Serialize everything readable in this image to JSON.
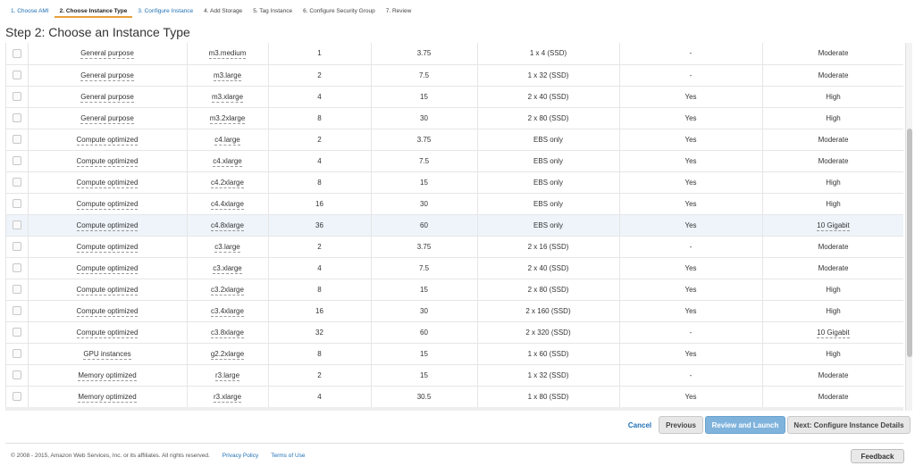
{
  "wizard": {
    "steps": [
      {
        "label": "1. Choose AMI"
      },
      {
        "label": "2. Choose Instance Type"
      },
      {
        "label": "3. Configure Instance"
      },
      {
        "label": "4. Add Storage"
      },
      {
        "label": "5. Tag Instance"
      },
      {
        "label": "6. Configure Security Group"
      },
      {
        "label": "7. Review"
      }
    ]
  },
  "page": {
    "title": "Step 2: Choose an Instance Type"
  },
  "table": {
    "rows": [
      {
        "family": "General purpose",
        "type": "m3.medium",
        "vcpus": "1",
        "memory": "3.75",
        "storage": "1 x 4 (SSD)",
        "ebs": "-",
        "network": "Moderate"
      },
      {
        "family": "General purpose",
        "type": "m3.large",
        "vcpus": "2",
        "memory": "7.5",
        "storage": "1 x 32 (SSD)",
        "ebs": "-",
        "network": "Moderate"
      },
      {
        "family": "General purpose",
        "type": "m3.xlarge",
        "vcpus": "4",
        "memory": "15",
        "storage": "2 x 40 (SSD)",
        "ebs": "Yes",
        "network": "High"
      },
      {
        "family": "General purpose",
        "type": "m3.2xlarge",
        "vcpus": "8",
        "memory": "30",
        "storage": "2 x 80 (SSD)",
        "ebs": "Yes",
        "network": "High"
      },
      {
        "family": "Compute optimized",
        "type": "c4.large",
        "vcpus": "2",
        "memory": "3.75",
        "storage": "EBS only",
        "ebs": "Yes",
        "network": "Moderate"
      },
      {
        "family": "Compute optimized",
        "type": "c4.xlarge",
        "vcpus": "4",
        "memory": "7.5",
        "storage": "EBS only",
        "ebs": "Yes",
        "network": "Moderate"
      },
      {
        "family": "Compute optimized",
        "type": "c4.2xlarge",
        "vcpus": "8",
        "memory": "15",
        "storage": "EBS only",
        "ebs": "Yes",
        "network": "High"
      },
      {
        "family": "Compute optimized",
        "type": "c4.4xlarge",
        "vcpus": "16",
        "memory": "30",
        "storage": "EBS only",
        "ebs": "Yes",
        "network": "High"
      },
      {
        "family": "Compute optimized",
        "type": "c4.8xlarge",
        "vcpus": "36",
        "memory": "60",
        "storage": "EBS only",
        "ebs": "Yes",
        "network": "10 Gigabit"
      },
      {
        "family": "Compute optimized",
        "type": "c3.large",
        "vcpus": "2",
        "memory": "3.75",
        "storage": "2 x 16 (SSD)",
        "ebs": "-",
        "network": "Moderate"
      },
      {
        "family": "Compute optimized",
        "type": "c3.xlarge",
        "vcpus": "4",
        "memory": "7.5",
        "storage": "2 x 40 (SSD)",
        "ebs": "Yes",
        "network": "Moderate"
      },
      {
        "family": "Compute optimized",
        "type": "c3.2xlarge",
        "vcpus": "8",
        "memory": "15",
        "storage": "2 x 80 (SSD)",
        "ebs": "Yes",
        "network": "High"
      },
      {
        "family": "Compute optimized",
        "type": "c3.4xlarge",
        "vcpus": "16",
        "memory": "30",
        "storage": "2 x 160 (SSD)",
        "ebs": "Yes",
        "network": "High"
      },
      {
        "family": "Compute optimized",
        "type": "c3.8xlarge",
        "vcpus": "32",
        "memory": "60",
        "storage": "2 x 320 (SSD)",
        "ebs": "-",
        "network": "10 Gigabit"
      },
      {
        "family": "GPU instances",
        "type": "g2.2xlarge",
        "vcpus": "8",
        "memory": "15",
        "storage": "1 x 60 (SSD)",
        "ebs": "Yes",
        "network": "High"
      },
      {
        "family": "Memory optimized",
        "type": "r3.large",
        "vcpus": "2",
        "memory": "15",
        "storage": "1 x 32 (SSD)",
        "ebs": "-",
        "network": "Moderate"
      },
      {
        "family": "Memory optimized",
        "type": "r3.xlarge",
        "vcpus": "4",
        "memory": "30.5",
        "storage": "1 x 80 (SSD)",
        "ebs": "Yes",
        "network": "Moderate"
      }
    ]
  },
  "actions": {
    "cancel": "Cancel",
    "previous": "Previous",
    "review": "Review and Launch",
    "next": "Next: Configure Instance Details"
  },
  "footer": {
    "copyright": "© 2008 - 2015, Amazon Web Services, Inc. or its affiliates. All rights reserved.",
    "privacy": "Privacy Policy",
    "terms": "Terms of Use",
    "feedback": "Feedback"
  },
  "colors": {
    "link": "#1f6fb5",
    "active_step_underline": "#e8a13a",
    "primary_button": "#7fb3dc",
    "highlight_row": "#eef4fa"
  }
}
